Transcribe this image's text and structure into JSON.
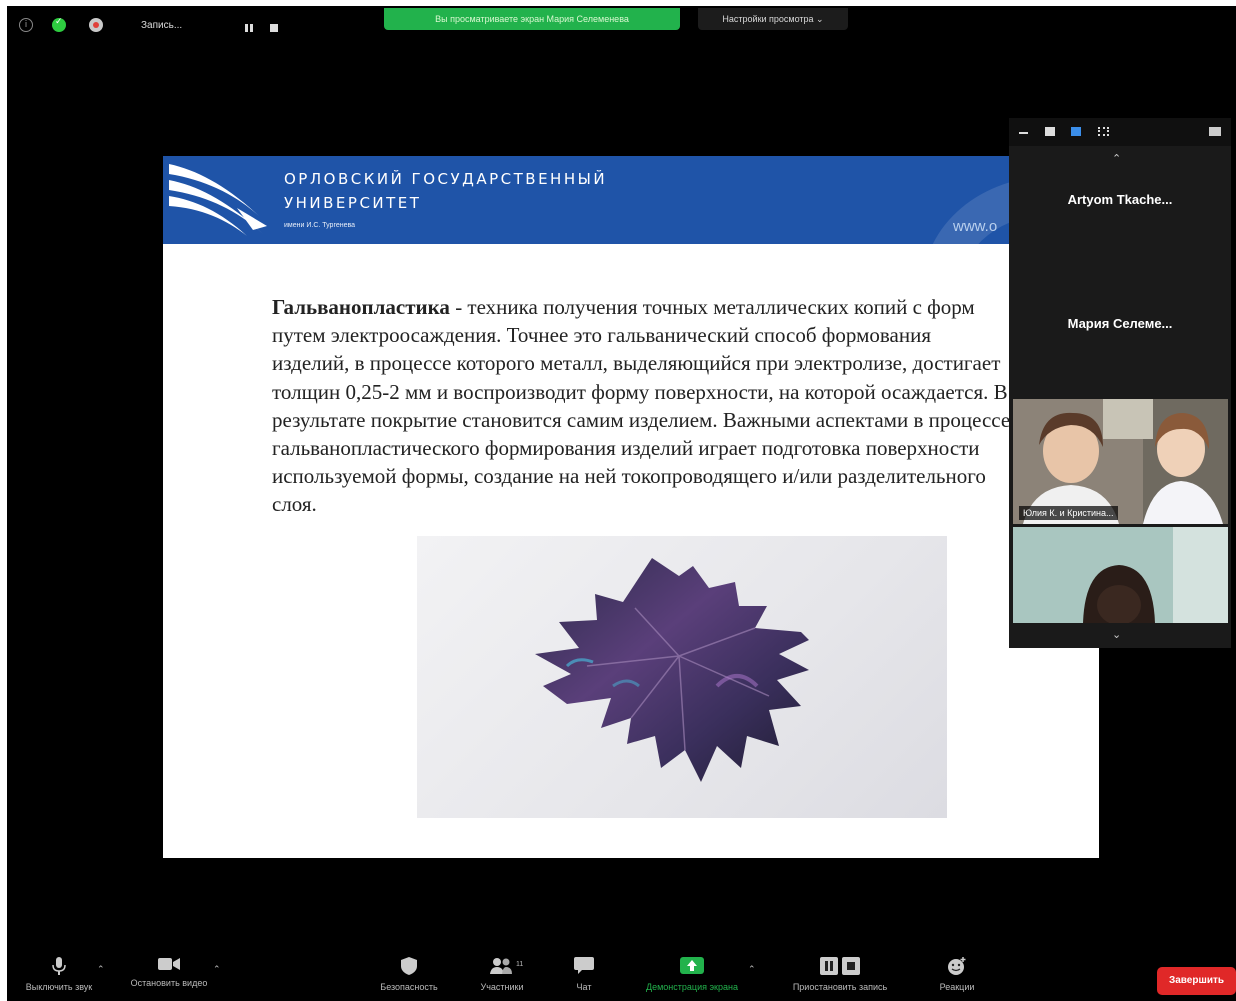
{
  "top_bar": {
    "recording_label": "Запись...",
    "viewing_banner": "Вы просматриваете экран Мария Селеменева",
    "view_options": "Настройки просмотра ⌄"
  },
  "slide": {
    "university_line1": "ОРЛОВСКИЙ ГОСУДАРСТВЕННЫЙ",
    "university_line2": "УНИВЕРСИТЕТ",
    "university_sub": "имени И.С. Тургенева",
    "url": "www.o",
    "term": "Гальванопластика",
    "body_text": " - техника получения точных металлических копий с форм путем электроосаждения. Точнее это гальванический способ формования изделий, в процессе которого металл, выделяющийся при электролизе, достигает толщин 0,25-2 мм и воспроизводит форму поверхности, на которой осаждается. В результате покрытие становится самим изделием. Важными аспектами в процессе гальванопластического формирования изделий играет подготовка поверхности используемой формы, создание на ней токопроводящего и/или разделительного слоя."
  },
  "participants": {
    "tiles": [
      {
        "name": "Artyom  Tkache..."
      },
      {
        "name": "Мария  Селеме..."
      }
    ],
    "video_tiles": [
      {
        "name": "Юлия К. и Кристина..."
      },
      {
        "name": ""
      }
    ]
  },
  "toolbar": {
    "mute_label": "Выключить звук",
    "video_label": "Остановить видео",
    "security_label": "Безопасность",
    "participants_label": "Участники",
    "participants_count": "11",
    "chat_label": "Чат",
    "share_label": "Демонстрация экрана",
    "pause_rec_label": "Приостановить запись",
    "reactions_label": "Реакции",
    "end_label": "Завершить"
  },
  "colors": {
    "banner_green": "#22b24c",
    "slide_blue": "#1f54a8",
    "end_red": "#e02828"
  }
}
